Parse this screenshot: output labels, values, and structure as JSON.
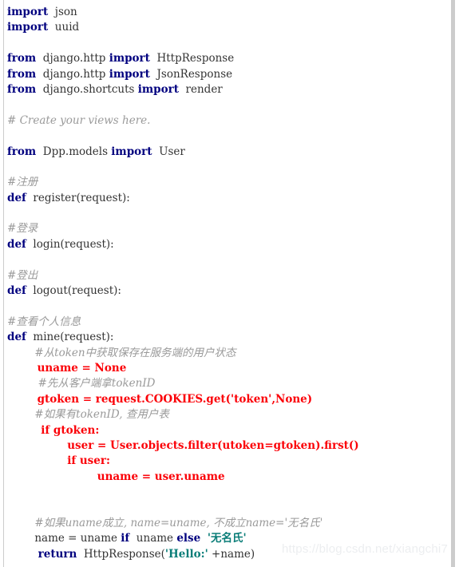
{
  "document": {
    "kind": "source-code-listing",
    "language": "Python",
    "watermark": "https://blog.csdn.net/xiangchi7",
    "colors": {
      "background": "#ffffff",
      "keyword": "#00007f",
      "identifier": "#333333",
      "comment": "#9a9a9a",
      "string": "#0a7d78",
      "highlight_red": "#fb0007",
      "frame_rule": "#cccccc",
      "watermark": "#eceef0"
    }
  },
  "code": {
    "lines": [
      {
        "n": 1,
        "text": "import  json",
        "tokens": [
          {
            "t": "import",
            "c": "kw"
          },
          {
            "t": "  json",
            "c": "id"
          }
        ]
      },
      {
        "n": 2,
        "text": "import  uuid",
        "tokens": [
          {
            "t": "import",
            "c": "kw"
          },
          {
            "t": "  uuid",
            "c": "id"
          }
        ]
      },
      {
        "n": 3,
        "text": "",
        "tokens": []
      },
      {
        "n": 4,
        "text": "from  django.http import  HttpResponse",
        "tokens": [
          {
            "t": "from",
            "c": "kw"
          },
          {
            "t": "  django.http ",
            "c": "id"
          },
          {
            "t": "import",
            "c": "kw"
          },
          {
            "t": "  HttpResponse",
            "c": "id"
          }
        ]
      },
      {
        "n": 5,
        "text": "from  django.http import  JsonResponse",
        "tokens": [
          {
            "t": "from",
            "c": "kw"
          },
          {
            "t": "  django.http ",
            "c": "id"
          },
          {
            "t": "import",
            "c": "kw"
          },
          {
            "t": "  JsonResponse",
            "c": "id"
          }
        ]
      },
      {
        "n": 6,
        "text": "from  django.shortcuts import  render",
        "tokens": [
          {
            "t": "from",
            "c": "kw"
          },
          {
            "t": "  django.shortcuts ",
            "c": "id"
          },
          {
            "t": "import",
            "c": "kw"
          },
          {
            "t": "  render",
            "c": "id"
          }
        ]
      },
      {
        "n": 7,
        "text": "",
        "tokens": []
      },
      {
        "n": 8,
        "text": "# Create your views here.",
        "tokens": [
          {
            "t": "# Create your views here.",
            "c": "cm"
          }
        ]
      },
      {
        "n": 9,
        "text": "",
        "tokens": []
      },
      {
        "n": 10,
        "text": "from  Dpp.models import  User",
        "tokens": [
          {
            "t": "from",
            "c": "kw"
          },
          {
            "t": "  Dpp.models ",
            "c": "id"
          },
          {
            "t": "import",
            "c": "kw"
          },
          {
            "t": "  User",
            "c": "id"
          }
        ]
      },
      {
        "n": 11,
        "text": "",
        "tokens": []
      },
      {
        "n": 12,
        "text": "#注册",
        "tokens": [
          {
            "t": "#注册",
            "c": "cm"
          }
        ]
      },
      {
        "n": 13,
        "text": "def  register(request):",
        "tokens": [
          {
            "t": "def",
            "c": "kw"
          },
          {
            "t": "  register(request):",
            "c": "id"
          }
        ]
      },
      {
        "n": 14,
        "text": "",
        "tokens": []
      },
      {
        "n": 15,
        "text": "#登录",
        "tokens": [
          {
            "t": "#登录",
            "c": "cm"
          }
        ]
      },
      {
        "n": 16,
        "text": "def  login(request):",
        "tokens": [
          {
            "t": "def",
            "c": "kw"
          },
          {
            "t": "  login(request):",
            "c": "id"
          }
        ]
      },
      {
        "n": 17,
        "text": "",
        "tokens": []
      },
      {
        "n": 18,
        "text": "#登出",
        "tokens": [
          {
            "t": "#登出",
            "c": "cm"
          }
        ]
      },
      {
        "n": 19,
        "text": "def  logout(request):",
        "tokens": [
          {
            "t": "def",
            "c": "kw"
          },
          {
            "t": "  logout(request):",
            "c": "id"
          }
        ]
      },
      {
        "n": 20,
        "text": "",
        "tokens": []
      },
      {
        "n": 21,
        "text": "#查看个人信息",
        "tokens": [
          {
            "t": "#查看个人信息",
            "c": "cm"
          }
        ]
      },
      {
        "n": 22,
        "text": "def  mine(request):",
        "tokens": [
          {
            "t": "def",
            "c": "kw"
          },
          {
            "t": "  mine(request):",
            "c": "id"
          }
        ]
      },
      {
        "n": 23,
        "text": "        #从token中获取保存在服务端的用户状态",
        "tokens": [
          {
            "t": "        #从token中获取保存在服务端的用户状态",
            "c": "cm"
          }
        ]
      },
      {
        "n": 24,
        "text": "        uname = None",
        "tokens": [
          {
            "t": "        uname = None",
            "c": "red"
          }
        ]
      },
      {
        "n": 25,
        "text": "         #先从客户端拿tokenID",
        "tokens": [
          {
            "t": "         #先从客户端拿tokenID",
            "c": "cm"
          }
        ]
      },
      {
        "n": 26,
        "text": "        gtoken = request.COOKIES.get('token',None)",
        "tokens": [
          {
            "t": "        gtoken = request.COOKIES.get('token',None)",
            "c": "red"
          }
        ]
      },
      {
        "n": 27,
        "text": "        #如果有tokenID, 查用户表",
        "tokens": [
          {
            "t": "        #如果有tokenID, 查用户表",
            "c": "cm"
          }
        ]
      },
      {
        "n": 28,
        "text": "         if gtoken:",
        "tokens": [
          {
            "t": "         if gtoken:",
            "c": "red"
          }
        ]
      },
      {
        "n": 29,
        "text": "                user = User.objects.filter(utoken=gtoken).first()",
        "tokens": [
          {
            "t": "                user = User.objects.filter(utoken=gtoken).first()",
            "c": "red"
          }
        ]
      },
      {
        "n": 30,
        "text": "                if user:",
        "tokens": [
          {
            "t": "                if user:",
            "c": "red"
          }
        ]
      },
      {
        "n": 31,
        "text": "                        uname = user.uname",
        "tokens": [
          {
            "t": "                        uname = user.uname",
            "c": "red"
          }
        ]
      },
      {
        "n": 32,
        "text": "",
        "tokens": []
      },
      {
        "n": 33,
        "text": "",
        "tokens": []
      },
      {
        "n": 34,
        "text": "        #如果uname成立, name=uname, 不成立name='无名氏'",
        "tokens": [
          {
            "t": "        #如果uname成立, name=uname, 不成立name='无名氏'",
            "c": "cm"
          }
        ]
      },
      {
        "n": 35,
        "text": "        name = uname if  uname else  '无名氏'",
        "tokens": [
          {
            "t": "        name = uname ",
            "c": "id"
          },
          {
            "t": "if",
            "c": "kw"
          },
          {
            "t": "  uname ",
            "c": "id"
          },
          {
            "t": "else",
            "c": "kw"
          },
          {
            "t": "  ",
            "c": "id"
          },
          {
            "t": "'无名氏'",
            "c": "str"
          }
        ]
      },
      {
        "n": 36,
        "text": "         return  HttpResponse('Hello:' +name)",
        "tokens": [
          {
            "t": "         ",
            "c": "id"
          },
          {
            "t": "return",
            "c": "kw"
          },
          {
            "t": "  HttpResponse(",
            "c": "id"
          },
          {
            "t": "'Hello:'",
            "c": "str"
          },
          {
            "t": " +name)",
            "c": "id"
          }
        ]
      }
    ]
  }
}
